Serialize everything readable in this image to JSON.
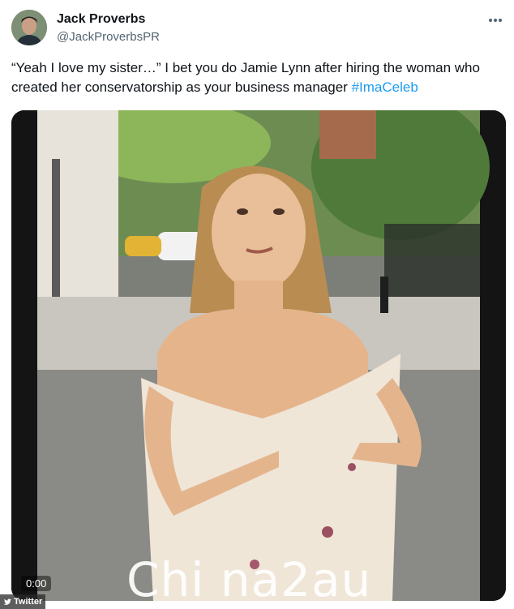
{
  "author": {
    "name": "Jack Proverbs",
    "handle": "@JackProverbsPR"
  },
  "tweet": {
    "text": "“Yeah I love my sister…” I bet you do Jamie Lynn after hiring the woman who created her conservatorship as your business manager",
    "hashtag": "#ImaCeleb"
  },
  "media": {
    "timestamp": "0:00",
    "watermark": "Chi na2au"
  },
  "source_badge": "Twitter",
  "colors": {
    "hashtag": "#1d9bf0",
    "handle": "#536471",
    "text": "#0f1419"
  },
  "icons": [
    "more-options-icon",
    "bird-icon",
    "avatar"
  ]
}
